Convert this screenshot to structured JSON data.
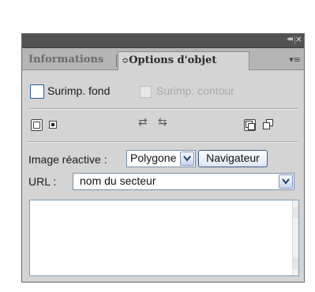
{
  "titlebar": {
    "collapse_glyph": "◂◂",
    "close_glyph": "×"
  },
  "tabs": [
    {
      "label": "Informations",
      "active": false
    },
    {
      "label": "Options d'objet",
      "active": true,
      "prefix": "≎"
    }
  ],
  "tab_menu_glyph": "▾≡",
  "overprint": {
    "fill_label": "Surimp. fond",
    "fill_checked": false,
    "stroke_label": "Surimp. contour",
    "stroke_enabled": false
  },
  "toolbar": {
    "swap_glyph_1": "⇄",
    "swap_glyph_2": "⇆"
  },
  "image_map": {
    "label": "Image réactive :",
    "shape_value": "Polygone",
    "navigator_label": "Navigateur"
  },
  "url": {
    "label": "URL :",
    "value": "nom du secteur"
  },
  "colors": {
    "panel_bg": "#d4d4d4",
    "titlebar_bg": "#535353",
    "tab_strip_bg": "#b5b5b5",
    "accent_border": "#2a5a9a"
  }
}
